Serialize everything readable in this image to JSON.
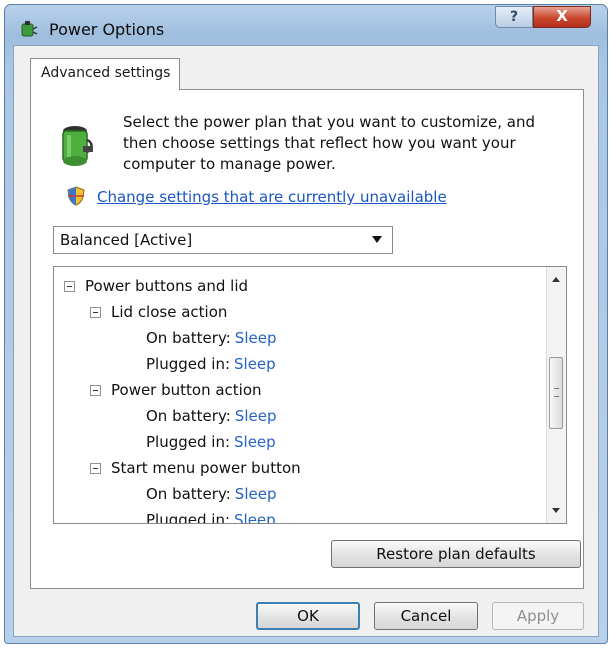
{
  "window": {
    "title": "Power Options",
    "help_label": "?",
    "close_label": "X"
  },
  "tab": {
    "label": "Advanced settings"
  },
  "intro_text": "Select the power plan that you want to customize, and then choose settings that reflect how you want your computer to manage power.",
  "change_settings_link": "Change settings that are currently unavailable",
  "plan_select": {
    "value": "Balanced [Active]"
  },
  "settings_tree": {
    "root": "Power buttons and lid",
    "groups": [
      {
        "label": "Lid close action",
        "on_battery": {
          "label": "On battery:",
          "value": "Sleep"
        },
        "plugged_in": {
          "label": "Plugged in:",
          "value": "Sleep"
        }
      },
      {
        "label": "Power button action",
        "on_battery": {
          "label": "On battery:",
          "value": "Sleep"
        },
        "plugged_in": {
          "label": "Plugged in:",
          "value": "Sleep"
        }
      },
      {
        "label": "Start menu power button",
        "on_battery": {
          "label": "On battery:",
          "value": "Sleep"
        },
        "plugged_in": {
          "label": "Plugged in:",
          "value": "Sleep"
        }
      }
    ]
  },
  "buttons": {
    "restore": "Restore plan defaults",
    "ok": "OK",
    "cancel": "Cancel",
    "apply": "Apply"
  },
  "icons": {
    "app": "power-options-icon",
    "battery": "battery-plug-icon",
    "shield": "uac-shield-icon"
  }
}
